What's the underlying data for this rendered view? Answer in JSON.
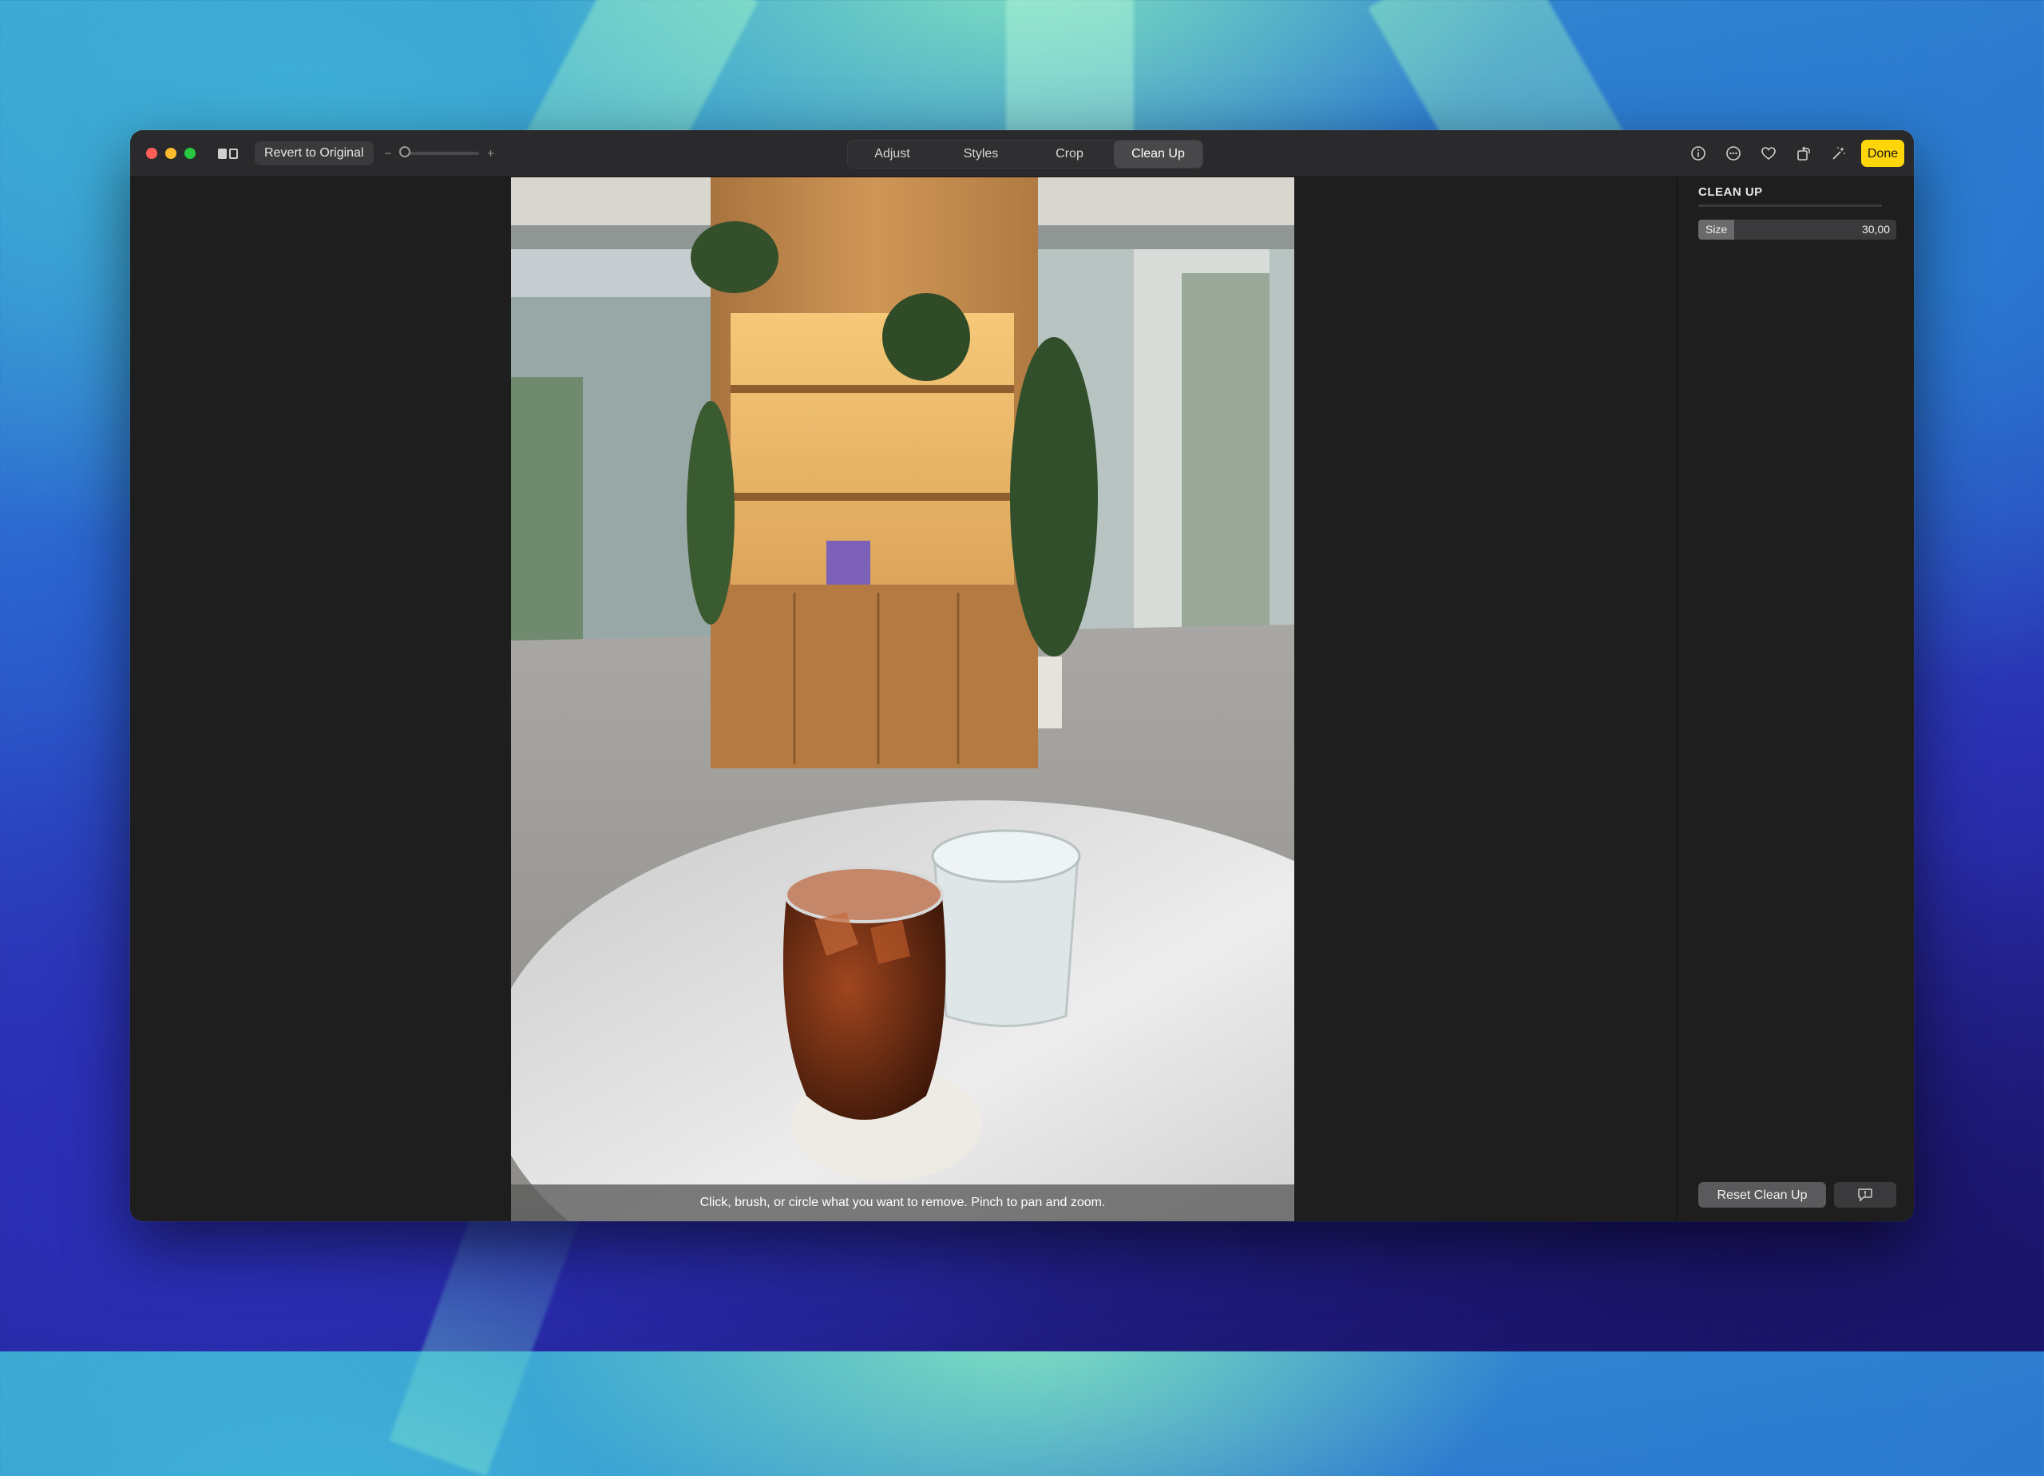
{
  "toolbar": {
    "revert_label": "Revert to Original",
    "zoom_minus": "−",
    "zoom_plus": "+",
    "tabs": [
      {
        "label": "Adjust",
        "active": false
      },
      {
        "label": "Styles",
        "active": false
      },
      {
        "label": "Crop",
        "active": false
      },
      {
        "label": "Clean Up",
        "active": true
      }
    ],
    "icons": [
      "info-icon",
      "more-icon",
      "heart-icon",
      "rotate-icon",
      "magic-wand-icon"
    ],
    "done_label": "Done",
    "accent": "#ffd60a"
  },
  "canvas": {
    "hint": "Click, brush, or circle what you want to remove. Pinch to pan and zoom."
  },
  "sidebar": {
    "title": "CLEAN UP",
    "size": {
      "label": "Size",
      "value": "30,00",
      "fraction": 0.18
    },
    "reset_label": "Reset Clean Up",
    "feedback_icon": "feedback-icon"
  }
}
